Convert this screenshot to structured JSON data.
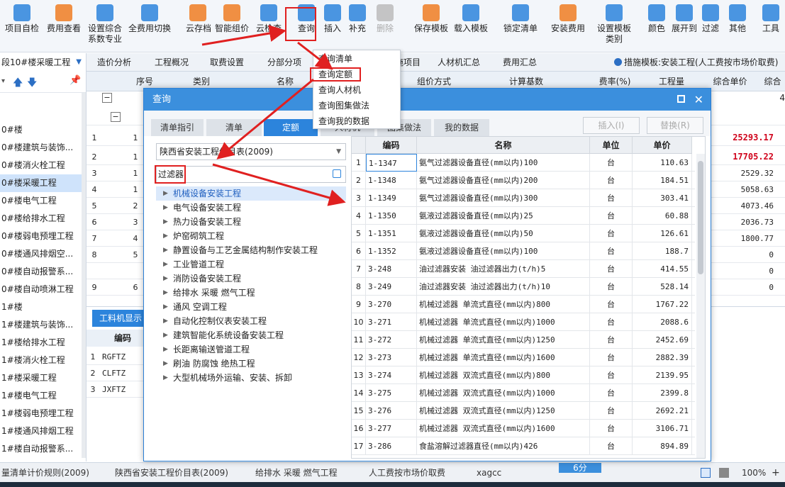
{
  "toolbar": {
    "items": [
      {
        "label": "项目自检",
        "icon": "check-doc-icon"
      },
      {
        "label": "费用查看",
        "icon": "doc-search-icon"
      },
      {
        "label": "设置综合",
        "label2": "系数专业",
        "icon": "coefficient-icon"
      },
      {
        "label": "全费用切换",
        "icon": "switch-icon"
      },
      {
        "label": "云存档",
        "icon": "cloud-save-icon"
      },
      {
        "label": "智能组价",
        "icon": "smart-price-icon"
      },
      {
        "label": "云检查",
        "icon": "cloud-check-icon"
      },
      {
        "label": "查询",
        "icon": "query-icon"
      },
      {
        "label": "插入",
        "icon": "insert-icon"
      },
      {
        "label": "补充",
        "icon": "supplement-icon"
      },
      {
        "label": "删除",
        "icon": "delete-icon"
      },
      {
        "label": "保存模板",
        "icon": "save-template-icon"
      },
      {
        "label": "载入模板",
        "icon": "load-template-icon"
      },
      {
        "label": "锁定清单",
        "icon": "lock-icon"
      },
      {
        "label": "安装费用",
        "icon": "coins-icon"
      },
      {
        "label": "设置模板",
        "label2": "类别",
        "icon": "template-category-icon"
      },
      {
        "label": "颜色",
        "icon": "paint-bucket-icon"
      },
      {
        "label": "展开到",
        "icon": "expand-tree-icon"
      },
      {
        "label": "过滤",
        "icon": "filter-icon"
      },
      {
        "label": "其他",
        "icon": "grid-more-icon"
      },
      {
        "label": "工具",
        "icon": "tool-icon"
      }
    ]
  },
  "tabbar": {
    "project": "段10#楼采暖工程",
    "tabs": [
      "造价分析",
      "工程概况",
      "取费设置",
      "分部分项",
      "措施项目",
      "人材机汇总",
      "费用汇总"
    ],
    "template_info": "措施模板:安装工程(人工费按市场价取费)"
  },
  "sidebar": {
    "items": [
      "0#楼",
      "0#楼建筑与装饰...",
      "0#楼消火栓工程",
      "0#楼采暖工程",
      "0#楼电气工程",
      "0#楼给排水工程",
      "0#楼弱电预埋工程",
      "0#楼通风排烟空...",
      "0#楼自动报警系...",
      "0#楼自动喷淋工程",
      "1#楼",
      "1#楼建筑与装饰...",
      "1#楼给排水工程",
      "1#楼消火栓工程",
      "1#楼采暖工程",
      "1#楼电气工程",
      "1#楼弱电预埋工程",
      "1#楼通风排烟工程",
      "1#楼自动报警系..."
    ],
    "selected_index": 3
  },
  "grid": {
    "headers": [
      "序号",
      "类别",
      "名称",
      "组价方式",
      "计算基数",
      "费率(%)",
      "工程量",
      "综合单价",
      "综合"
    ],
    "rows": [
      {
        "n": "1",
        "seq": "1",
        "price": "25293.17",
        "red": true
      },
      {
        "n": "2",
        "seq": "1",
        "price": "17705.22",
        "red": true
      },
      {
        "n": "3",
        "seq": "1",
        "price": "2529.32",
        "red": false
      },
      {
        "n": "4",
        "seq": "1",
        "price": "5058.63",
        "red": false
      },
      {
        "n": "5",
        "seq": "2",
        "price": "4073.46",
        "red": false
      },
      {
        "n": "6",
        "seq": "3",
        "price": "2036.73",
        "red": false
      },
      {
        "n": "7",
        "seq": "4",
        "price": "1800.77",
        "red": false
      },
      {
        "n": "8",
        "seq": "5",
        "price": "0",
        "red": false
      },
      {
        "n": "",
        "seq": "",
        "price": "0",
        "red": false
      },
      {
        "n": "9",
        "seq": "6",
        "price": "0",
        "red": false
      }
    ],
    "top_right_value": "4"
  },
  "bottom_pane": {
    "tab": "工料机显示",
    "header": "编码",
    "rows": [
      {
        "n": "1",
        "code": "RGFTZ"
      },
      {
        "n": "2",
        "code": "CLFTZ"
      },
      {
        "n": "3",
        "code": "JXFTZ"
      }
    ]
  },
  "status": {
    "items": [
      "量清单计价规则(2009)",
      "陕西省安装工程价目表(2009)",
      "给排水 采暖 燃气工程",
      "人工费按市场价取费",
      "xagcc",
      "6分"
    ],
    "zoom": "100%"
  },
  "query_menu": {
    "items": [
      "查询清单",
      "查询定额",
      "查询人材机",
      "查询图集做法",
      "查询我的数据"
    ],
    "highlighted": "查询定额"
  },
  "dialog": {
    "title": "查询",
    "tabs": [
      "清单指引",
      "清单",
      "定额",
      "人材机",
      "图集做法",
      "我的数据"
    ],
    "active_tab": "定额",
    "insert_button": "插入(I)",
    "replace_button": "替换(R)",
    "library": "陕西省安装工程价目表(2009)",
    "search_value": "过滤器",
    "tree": [
      "机械设备安装工程",
      "电气设备安装工程",
      "热力设备安装工程",
      "炉窑砌筑工程",
      "静置设备与工艺金属结构制作安装工程",
      "工业管道工程",
      "消防设备安装工程",
      "给排水 采暖 燃气工程",
      "通风 空调工程",
      "自动化控制仪表安装工程",
      "建筑智能化系统设备安装工程",
      "长距离输送管道工程",
      "刷油 防腐蚀 绝热工程",
      "大型机械场外运输、安装、拆卸"
    ],
    "results_headers": [
      "编码",
      "名称",
      "单位",
      "单价"
    ],
    "results": [
      {
        "n": "1",
        "code": "1-1347",
        "name": "氨气过滤器设备直径(mm以内)100",
        "unit": "台",
        "price": "110.63"
      },
      {
        "n": "2",
        "code": "1-1348",
        "name": "氨气过滤器设备直径(mm以内)200",
        "unit": "台",
        "price": "184.51"
      },
      {
        "n": "3",
        "code": "1-1349",
        "name": "氨气过滤器设备直径(mm以内)300",
        "unit": "台",
        "price": "303.41"
      },
      {
        "n": "4",
        "code": "1-1350",
        "name": "氨液过滤器设备直径(mm以内)25",
        "unit": "台",
        "price": "60.88"
      },
      {
        "n": "5",
        "code": "1-1351",
        "name": "氨液过滤器设备直径(mm以内)50",
        "unit": "台",
        "price": "126.61"
      },
      {
        "n": "6",
        "code": "1-1352",
        "name": "氨液过滤器设备直径(mm以内)100",
        "unit": "台",
        "price": "188.7"
      },
      {
        "n": "7",
        "code": "3-248",
        "name": "油过滤器安装 油过滤器出力(t/h)5",
        "unit": "台",
        "price": "414.55"
      },
      {
        "n": "8",
        "code": "3-249",
        "name": "油过滤器安装 油过滤器出力(t/h)10",
        "unit": "台",
        "price": "528.14"
      },
      {
        "n": "9",
        "code": "3-270",
        "name": "机械过滤器 单流式直径(mm以内)800",
        "unit": "台",
        "price": "1767.22"
      },
      {
        "n": "10",
        "code": "3-271",
        "name": "机械过滤器 单流式直径(mm以内)1000",
        "unit": "台",
        "price": "2088.6"
      },
      {
        "n": "11",
        "code": "3-272",
        "name": "机械过滤器 单流式直径(mm以内)1250",
        "unit": "台",
        "price": "2452.69"
      },
      {
        "n": "12",
        "code": "3-273",
        "name": "机械过滤器 单流式直径(mm以内)1600",
        "unit": "台",
        "price": "2882.39"
      },
      {
        "n": "13",
        "code": "3-274",
        "name": "机械过滤器 双流式直径(mm以内)800",
        "unit": "台",
        "price": "2139.95"
      },
      {
        "n": "14",
        "code": "3-275",
        "name": "机械过滤器 双流式直径(mm以内)1000",
        "unit": "台",
        "price": "2399.8"
      },
      {
        "n": "15",
        "code": "3-276",
        "name": "机械过滤器 双流式直径(mm以内)1250",
        "unit": "台",
        "price": "2692.21"
      },
      {
        "n": "16",
        "code": "3-277",
        "name": "机械过滤器 双流式直径(mm以内)1600",
        "unit": "台",
        "price": "3106.71"
      },
      {
        "n": "17",
        "code": "3-286",
        "name": "食盐溶解过滤器直径(mm以内)426",
        "unit": "台",
        "price": "894.89"
      }
    ]
  },
  "colors": {
    "accent": "#2c84dc",
    "highlight": "#e02020",
    "red_value": "#d0021b"
  }
}
